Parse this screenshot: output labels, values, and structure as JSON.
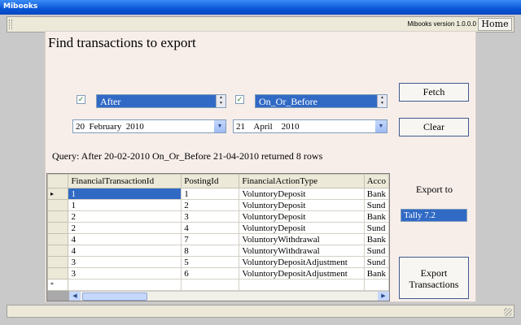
{
  "window": {
    "title": "Mibooks"
  },
  "topbar": {
    "version": "Mibooks version 1.0.0.0",
    "home_label": "Home"
  },
  "panel": {
    "heading": "Find transactions to export"
  },
  "filters": {
    "first": {
      "checked": true,
      "operator": "After",
      "date": {
        "day": "20",
        "month": "February",
        "year": "2010"
      }
    },
    "second": {
      "checked": true,
      "operator": "On_Or_Before",
      "date": {
        "day": "21",
        "month": "April",
        "year": "2010"
      }
    }
  },
  "buttons": {
    "fetch": "Fetch",
    "clear": "Clear",
    "export_line1": "Export",
    "export_line2": "Transactions"
  },
  "query_text": "Query: After 20-02-2010 On_Or_Before 21-04-2010 returned 8 rows",
  "grid": {
    "columns": [
      "FinancialTransactionId",
      "PostingId",
      "FinancialActionType",
      "Acco"
    ],
    "rows": [
      [
        "1",
        "1",
        "VoluntoryDeposit",
        "Bank"
      ],
      [
        "1",
        "2",
        "VoluntoryDeposit",
        "Sund"
      ],
      [
        "2",
        "3",
        "VoluntoryDeposit",
        "Bank"
      ],
      [
        "2",
        "4",
        "VoluntoryDeposit",
        "Sund"
      ],
      [
        "4",
        "7",
        "VoluntoryWithdrawal",
        "Bank"
      ],
      [
        "4",
        "8",
        "VoluntoryWithdrawal",
        "Sund"
      ],
      [
        "3",
        "5",
        "VoluntoryDepositAdjustment",
        "Sund"
      ],
      [
        "3",
        "6",
        "VoluntoryDepositAdjustment",
        "Bank"
      ]
    ],
    "current_row_marker": "▸",
    "new_row_marker": "*"
  },
  "export": {
    "label": "Export to",
    "selected": "Tally 7.2"
  },
  "icons": {
    "check": "✓",
    "spin_up": "▲",
    "spin_down": "▼",
    "dropdown": "▼",
    "scroll_left": "◀",
    "scroll_right": "▶"
  }
}
